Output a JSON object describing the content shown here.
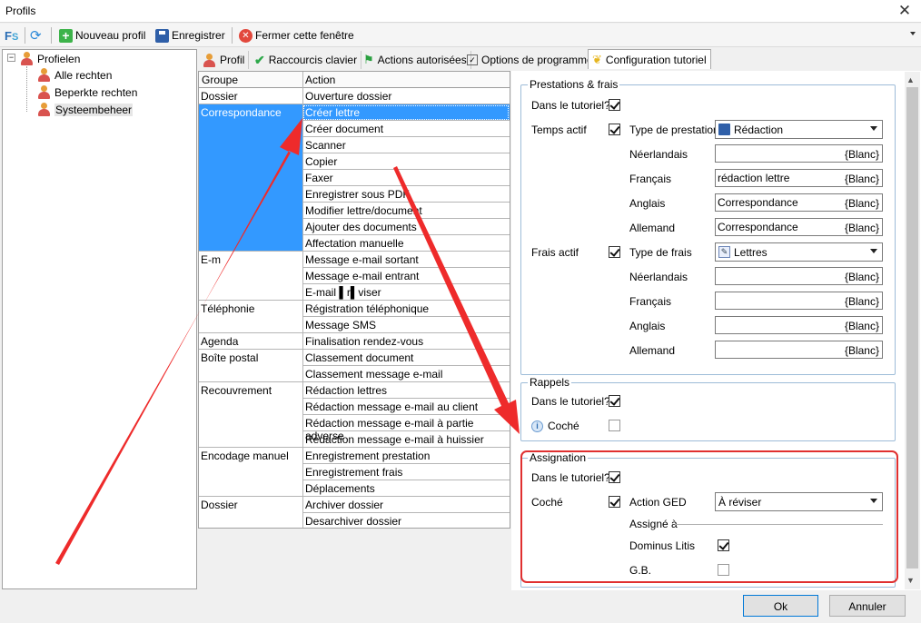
{
  "window": {
    "title": "Profils"
  },
  "toolbar": {
    "new_profile": "Nouveau profil",
    "save": "Enregistrer",
    "close_window": "Fermer cette fenêtre"
  },
  "tree": {
    "root": "Profielen",
    "items": [
      "Alle rechten",
      "Beperkte rechten",
      "Systeembeheer"
    ]
  },
  "tabs": [
    "Profil",
    "Raccourcis clavier",
    "Actions autorisées",
    "Options de programme",
    "Configuration tutoriel"
  ],
  "grid": {
    "headers": {
      "group": "Groupe",
      "action": "Action"
    },
    "groups": [
      {
        "name": "Dossier",
        "actions": [
          "Ouverture dossier"
        ]
      },
      {
        "name": "Correspondance",
        "actions": [
          "Créer lettre",
          "Créer document",
          "Scanner",
          "Copier",
          "Faxer",
          "Enregistrer sous PDF",
          "Modifier lettre/document",
          "Ajouter des documents",
          "Affectation manuelle"
        ]
      },
      {
        "name": "E-m",
        "actions": [
          "Message e-mail sortant",
          "Message e-mail entrant",
          "E-mail ▌r▌viser"
        ]
      },
      {
        "name": "Téléphonie",
        "actions": [
          "Régistration téléphonique",
          "Message SMS"
        ]
      },
      {
        "name": "Agenda",
        "actions": [
          "Finalisation rendez-vous"
        ]
      },
      {
        "name": "Boîte postal",
        "actions": [
          "Classement document",
          "Classement message e-mail"
        ]
      },
      {
        "name": "Recouvrement",
        "actions": [
          "Rédaction lettres",
          "Rédaction message e-mail au client",
          "Rédaction message e-mail à partie adverse",
          "Rédaction message e-mail à huissier"
        ]
      },
      {
        "name": "Encodage manuel",
        "actions": [
          "Enregistrement prestation",
          "Enregistrement frais",
          "Déplacements"
        ]
      },
      {
        "name": "Dossier",
        "actions": [
          "Archiver dossier",
          "Desarchiver dossier"
        ]
      }
    ]
  },
  "prestations": {
    "title": "Prestations & frais",
    "in_tutorial": "Dans le tutoriel?",
    "time_active": "Temps actif",
    "type_prestation": "Type de prestation",
    "type_prestation_value": "Rédaction",
    "fees_active": "Frais actif",
    "type_frais": "Type de frais",
    "type_frais_value": "Lettres",
    "lang_labels": [
      "Néerlandais",
      "Français",
      "Anglais",
      "Allemand"
    ],
    "time_values": [
      "",
      "rédaction lettre",
      "Correspondance",
      "Correspondance"
    ],
    "blanc": "{Blanc}"
  },
  "rappels": {
    "title": "Rappels",
    "in_tutorial": "Dans le tutoriel?",
    "checked": "Coché"
  },
  "assignation": {
    "title": "Assignation",
    "in_tutorial": "Dans le tutoriel?",
    "checked": "Coché",
    "action_ged": "Action GED",
    "action_ged_value": "À réviser",
    "assigned_to": "Assigné à",
    "users": [
      "Dominus Litis",
      "G.B."
    ]
  },
  "buttons": {
    "ok": "Ok",
    "cancel": "Annuler"
  },
  "colors": {
    "selection": "#3399ff",
    "highlight_box": "#e03030",
    "arrow": "#ee2b2b"
  }
}
